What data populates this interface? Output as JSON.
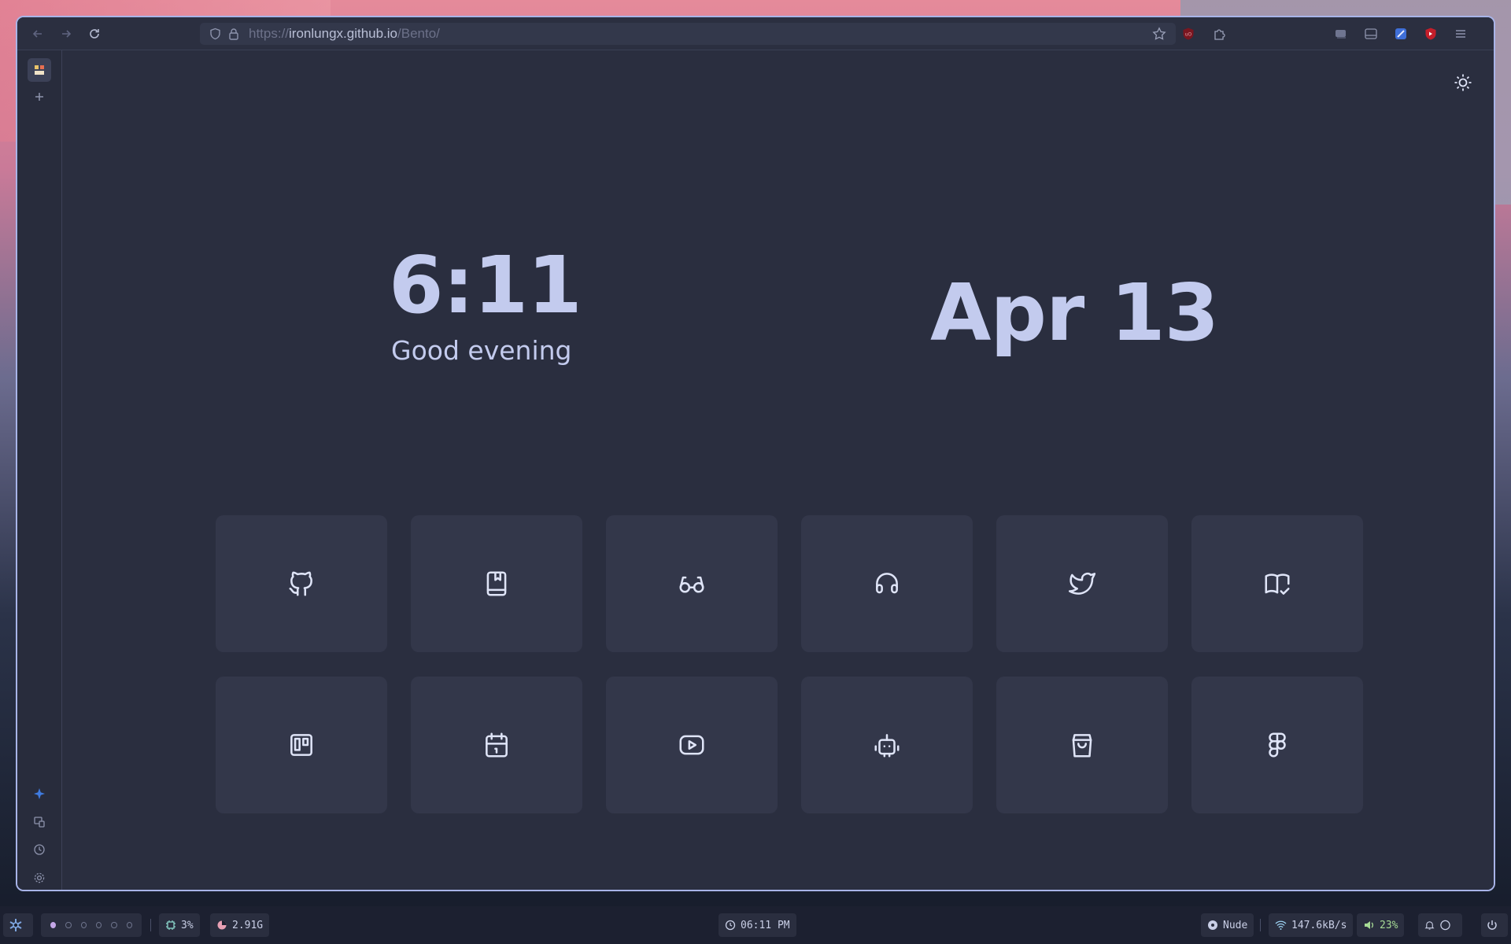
{
  "browser": {
    "url_scheme": "https://",
    "url_host": "ironlungx.github.io",
    "url_path": "/Bento/"
  },
  "page": {
    "clock": "6:11",
    "greeting": "Good evening",
    "date": "Apr 13",
    "links": [
      {
        "icon": "github-icon"
      },
      {
        "icon": "bookmark-book-icon"
      },
      {
        "icon": "eyeglasses-icon"
      },
      {
        "icon": "headphones-icon"
      },
      {
        "icon": "twitter-icon"
      },
      {
        "icon": "book-check-icon"
      },
      {
        "icon": "trello-board-icon"
      },
      {
        "icon": "calendar-icon"
      },
      {
        "icon": "youtube-icon"
      },
      {
        "icon": "robot-icon"
      },
      {
        "icon": "shopping-bag-icon"
      },
      {
        "icon": "figma-icon"
      }
    ]
  },
  "taskbar": {
    "cpu": "3%",
    "memory": "2.91G",
    "time": "06:11 PM",
    "music": "Nude",
    "network": "147.6kB/s",
    "volume": "23%"
  },
  "colors": {
    "accent": "#c3cbee",
    "background": "#2a2e3f",
    "card": "#33374a",
    "window_border": "#a8b4e8"
  }
}
